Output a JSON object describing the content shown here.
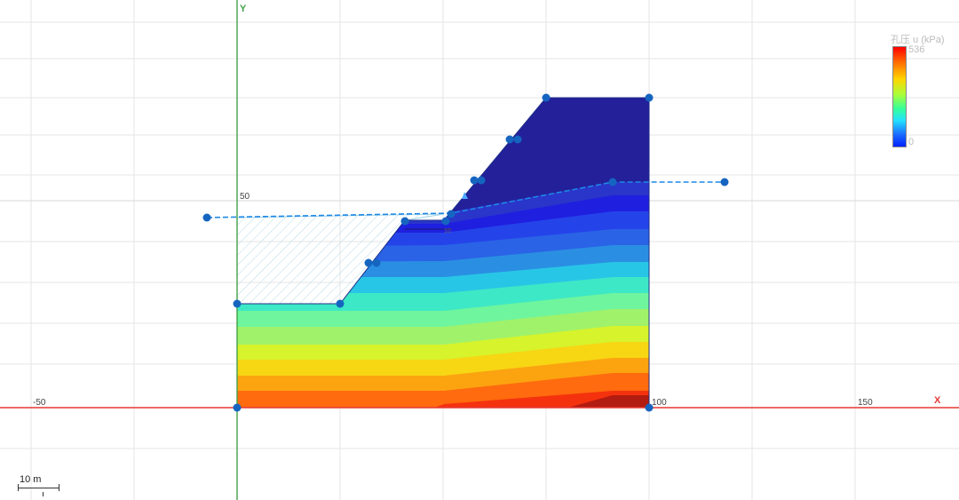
{
  "axes": {
    "x_name": "X",
    "y_name": "Y",
    "x_ticks": [
      "-50",
      "100",
      "150"
    ],
    "y_ticks": [
      "50"
    ]
  },
  "colors": {
    "x_axis": "#e53935",
    "y_axis": "#43a047",
    "geometry_point": "#1565c0",
    "water_table": "#1e88e5",
    "top_zone": "#23209a"
  },
  "legend": {
    "title": "孔压 u (kPa)",
    "max": "536",
    "min": "0",
    "colors": [
      "#ff0000",
      "#ff6a00",
      "#ffd400",
      "#a8ff3a",
      "#35ff9a",
      "#22e0ff",
      "#1a6bff",
      "#0022ff"
    ]
  },
  "annotation": {
    "small_label": "10"
  },
  "scale_bar": {
    "label": "10 m"
  }
}
